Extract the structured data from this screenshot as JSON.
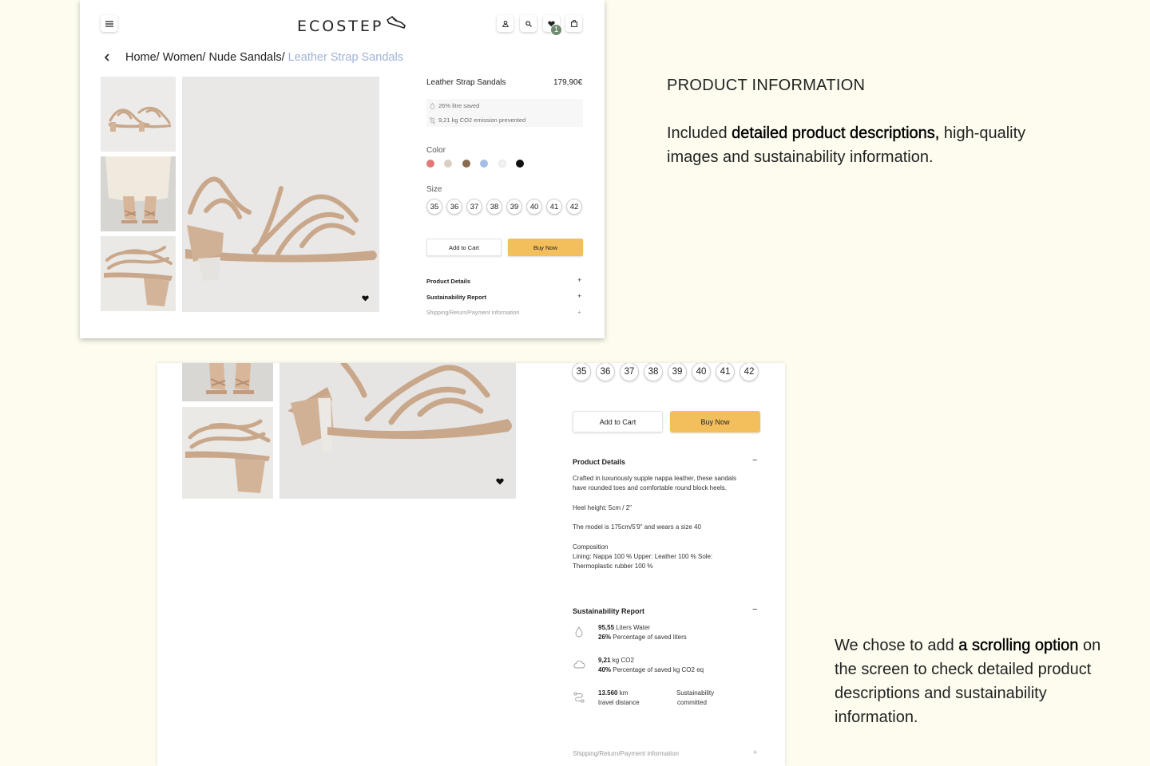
{
  "header": {
    "logo_text": "ECOSTEP",
    "wishlist_count": "1",
    "icons": [
      "menu-icon",
      "user-icon",
      "search-icon",
      "heart-icon",
      "bag-icon",
      "sneaker-logo-icon"
    ]
  },
  "breadcrumb": {
    "path": "Home/ Women/ Nude Sandals/",
    "current": "Leather Strap Sandals"
  },
  "product": {
    "title": "Leather Strap Sandals",
    "price": "179,90€",
    "sustainability_lines": [
      "26% litre saved",
      "9,21 kg CO2 emission prevented"
    ],
    "color_label": "Color",
    "colors": [
      "#e07a78",
      "#d9d0c4",
      "#8a6a4f",
      "#a6bde6",
      "#f4f2ee",
      "#111111"
    ],
    "size_label": "Size",
    "sizes": [
      "35",
      "36",
      "37",
      "38",
      "39",
      "40",
      "41",
      "42"
    ],
    "add_to_cart": "Add to Cart",
    "buy_now": "Buy Now"
  },
  "accordion": {
    "details_title": "Product Details",
    "sustainability_title": "Sustainability Report",
    "shipping_title": "Shipping/Return/Payment information",
    "expand_sign": "+",
    "collapse_sign": "−"
  },
  "details": {
    "description": "Crafted in luxuriously supple nappa leather, these sandals have rounded toes and comfortable round block heels.",
    "heel": "Heel height: 5cm / 2\"",
    "model": "The model is 175cm/5'9\" and wears a size 40",
    "composition_label": "Composition",
    "composition": "Lining: Nappa 100 % Upper: Leather 100 % Sole: Thermoplastic rubber 100 %"
  },
  "sustainability_report": {
    "water_value": "95,55",
    "water_unit": " Liters Water",
    "water_pct": "26%",
    "water_pct_label": " Percentage of saved liters",
    "co2_value": "9,21",
    "co2_unit": "  kg CO2",
    "co2_pct": "40%",
    "co2_pct_label": "  Percentage of saved kg CO2 eq",
    "distance_value": "13.560",
    "distance_unit": " km",
    "distance_label": "travel distance",
    "committed_1": "Sustainability",
    "committed_2": "committed"
  },
  "side": {
    "heading": "PRODUCT INFORMATION",
    "p1_a": "Included ",
    "p1_b": "detailed product descriptions,",
    "p1_c": " high-quality images and sustainability information.",
    "p2_a": "We chose to add ",
    "p2_b": "a scrolling option",
    "p2_c": " on the screen to check detailed product descriptions and sustainability information."
  },
  "colors": {
    "background": "#fdfcef",
    "accent": "#f3bf5c",
    "breadcrumb_current": "#9fb2d6",
    "badge": "#6f8a6e"
  }
}
